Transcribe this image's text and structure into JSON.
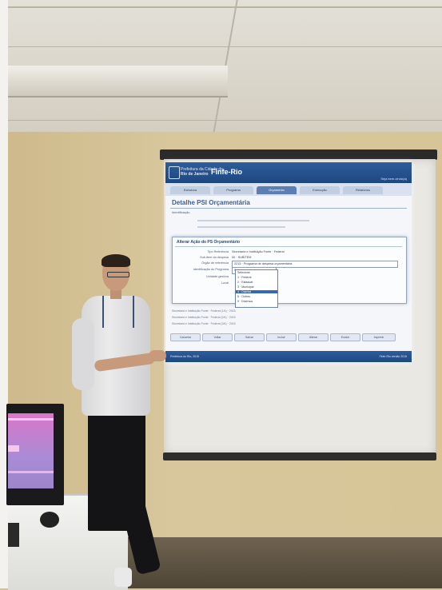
{
  "projected_app": {
    "org_line1": "Prefeitura da Cidade do",
    "org_line2": "Rio de Janeiro",
    "app_name": "Finfe-Rio",
    "user_info": "Seja bem-vindo(a)",
    "tabs": [
      "Estrutura",
      "Programa",
      "Orçamento",
      "Execução",
      "Relatórios"
    ],
    "page_title": "Detalhe PSI Orçamentária",
    "section": "Identificação",
    "modal": {
      "title": "Alterar Ação do PS Orçamentário",
      "fields": [
        {
          "label": "Tipo Referência",
          "value": "Secretaria e Instituição Fonte · Federal"
        },
        {
          "label": "Sub-item da despesa",
          "value": "00 · SUBITEM"
        },
        {
          "label": "Órgão de referência",
          "value": "2215 · Programa de despesa orçamentária"
        }
      ],
      "select_label": "Identificação do Programa",
      "select_value": "Selecione",
      "extra_labels": [
        "Unidade gestora",
        "Local"
      ],
      "dropdown_options": [
        "Selecione",
        "1 · Federal",
        "2 · Estadual",
        "3 · Municipal",
        "4 · Distrital",
        "5 · Outros",
        "9 · Diversos"
      ],
      "dropdown_selected_index": 4
    },
    "table_rows": [
      "Secretaria e Instituição Fonte · Federal (1/4) · 2015",
      "Secretaria e Instituição Fonte · Federal (2/4) · 2015",
      "Secretaria e Instituição Fonte · Federal (3/4) · 2015"
    ],
    "buttons": [
      "Cancelar",
      "Voltar",
      "Salvar",
      "Incluir",
      "Alterar",
      "Excluir",
      "Imprimir"
    ],
    "footer_left": "Prefeitura do Rio, 2015",
    "footer_right": "Finfe-Rio versão 2015"
  },
  "colors": {
    "app_blue": "#1d4780",
    "dropdown_highlight": "#3569b5",
    "wall": "#d8c79d",
    "monitor_screen": "#d977c9"
  }
}
